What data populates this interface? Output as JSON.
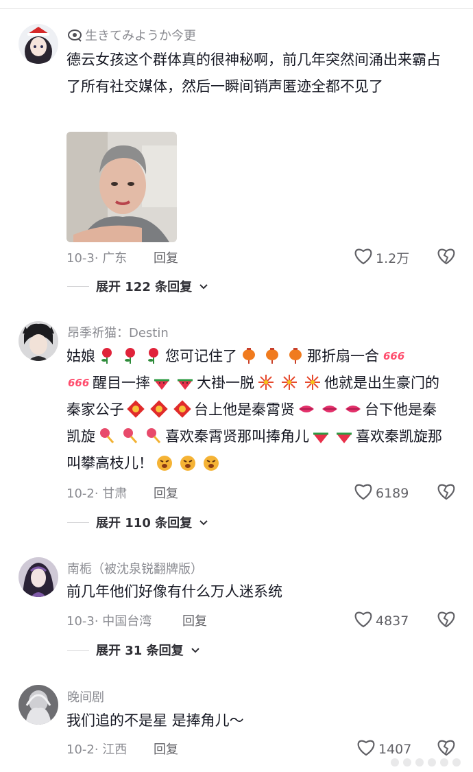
{
  "comments": [
    {
      "username": "生きてみようか今更",
      "text": "德云女孩这个群体真的很神秘啊，前几年突然间涌出来霸占了所有社交媒体，然后一瞬间销声匿迹全都不见了",
      "date_location": "10-3· 广东",
      "reply_label": "回复",
      "likes": "1.2万",
      "expand_label": "展开 122 条回复"
    },
    {
      "username": "昂季祈猫：Destin",
      "text_parts": [
        "姑娘",
        "您可记住了",
        "那折扇一合",
        "醒目一摔",
        "大褂一脱",
        "他就是出生豪门的秦家公子",
        "台上他是秦霄贤",
        "台下他是秦凯旋",
        "喜欢秦霄贤那叫捧角儿",
        "喜欢秦凯旋那叫攀高枝儿！"
      ],
      "date_location": "10-2· 甘肃",
      "reply_label": "回复",
      "likes": "6189",
      "expand_label": "展开 110 条回复"
    },
    {
      "username": "南栀（被沈泉锐翻牌版）",
      "text": "前几年他们好像有什么万人迷系统",
      "date_location": "10-3· 中国台湾",
      "reply_label": "回复",
      "likes": "4837",
      "expand_label": "展开 31 条回复"
    },
    {
      "username": "晚间剧",
      "text": "我们追的不是星 是捧角儿～",
      "date_location": "10-2· 江西",
      "reply_label": "回复",
      "likes": "1407"
    }
  ],
  "icons": {
    "username_badge": "eye-badge-icon",
    "like": "heart-outline-icon",
    "dislike": "broken-heart-icon",
    "expand": "chevron-down-icon",
    "emojis": [
      "rose-emoji",
      "lantern-emoji",
      "666-emoji",
      "watermelon-emoji",
      "firework-emoji",
      "fu-emoji",
      "lips-emoji",
      "rattle-emoji",
      "angry-dog-emoji"
    ]
  },
  "colors": {
    "text": "#161823",
    "secondary": "#8a8b91",
    "action": "#616166"
  }
}
